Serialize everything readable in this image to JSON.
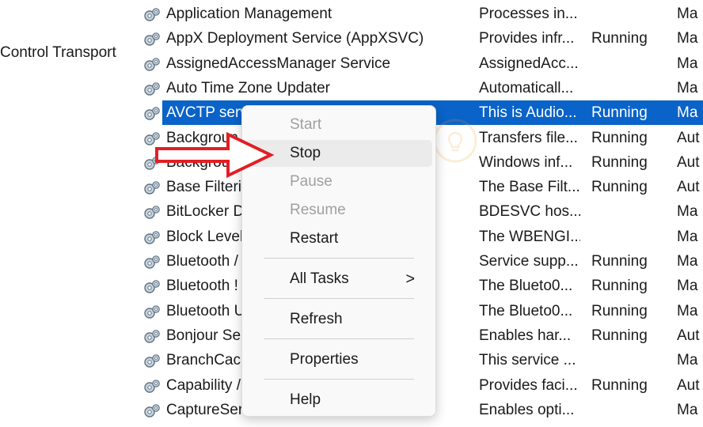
{
  "left_label": "Control Transport",
  "services": [
    {
      "name": "Application Management",
      "description": "Processes in...",
      "status": "",
      "startup": "Ma"
    },
    {
      "name": "AppX Deployment Service (AppXSVC)",
      "description": "Provides infr...",
      "status": "Running",
      "startup": "Ma"
    },
    {
      "name": "AssignedAccessManager Service",
      "description": "AssignedAcc...",
      "status": "",
      "startup": "Ma"
    },
    {
      "name": "Auto Time Zone Updater",
      "description": "Automaticall...",
      "status": "",
      "startup": "Ma"
    },
    {
      "name": "AVCTP serv",
      "description": "This is Audio...",
      "status": "Running",
      "startup": "Ma"
    },
    {
      "name": "Backgroun",
      "description": "Transfers file...",
      "status": "Running",
      "startup": "Aut"
    },
    {
      "name": "Backgroun",
      "description": "Windows inf...",
      "status": "Running",
      "startup": "Aut"
    },
    {
      "name": "Base Filteri",
      "description": "The Base Filt...",
      "status": "Running",
      "startup": "Aut"
    },
    {
      "name": "BitLocker D",
      "description": "BDESVC hos...",
      "status": "",
      "startup": "Ma"
    },
    {
      "name": "Block Level",
      "description": "The WBENGI...",
      "status": "",
      "startup": "Ma"
    },
    {
      "name": "Bluetooth /",
      "description": "Service supp...",
      "status": "Running",
      "startup": "Ma"
    },
    {
      "name": "Bluetooth !",
      "description": "The Blueto0...",
      "status": "Running",
      "startup": "Ma"
    },
    {
      "name": "Bluetooth U                                        /a",
      "description": "The Blueto0...",
      "status": "Running",
      "startup": "Ma"
    },
    {
      "name": "Bonjour Se",
      "description": "Enables har...",
      "status": "Running",
      "startup": "Aut"
    },
    {
      "name": "BranchCacl",
      "description": "This service ...",
      "status": "",
      "startup": "Ma"
    },
    {
      "name": "Capability /",
      "description": "Provides faci...",
      "status": "Running",
      "startup": "Aut"
    },
    {
      "name": "CaptureSer",
      "description": "Enables opti...",
      "status": "",
      "startup": "Ma"
    }
  ],
  "selected_index": 4,
  "context_menu": {
    "start": "Start",
    "stop": "Stop",
    "pause": "Pause",
    "resume": "Resume",
    "restart": "Restart",
    "all_tasks": "All Tasks",
    "refresh": "Refresh",
    "properties": "Properties",
    "help": "Help",
    "submenu_chevron": ">"
  },
  "colors": {
    "selection": "#0a63c8",
    "arrow": "#e31e24"
  },
  "icons": {
    "service": "gear-pair-icon",
    "pointer": "red-arrow-icon",
    "watermark": "lightbulb-watermark"
  }
}
